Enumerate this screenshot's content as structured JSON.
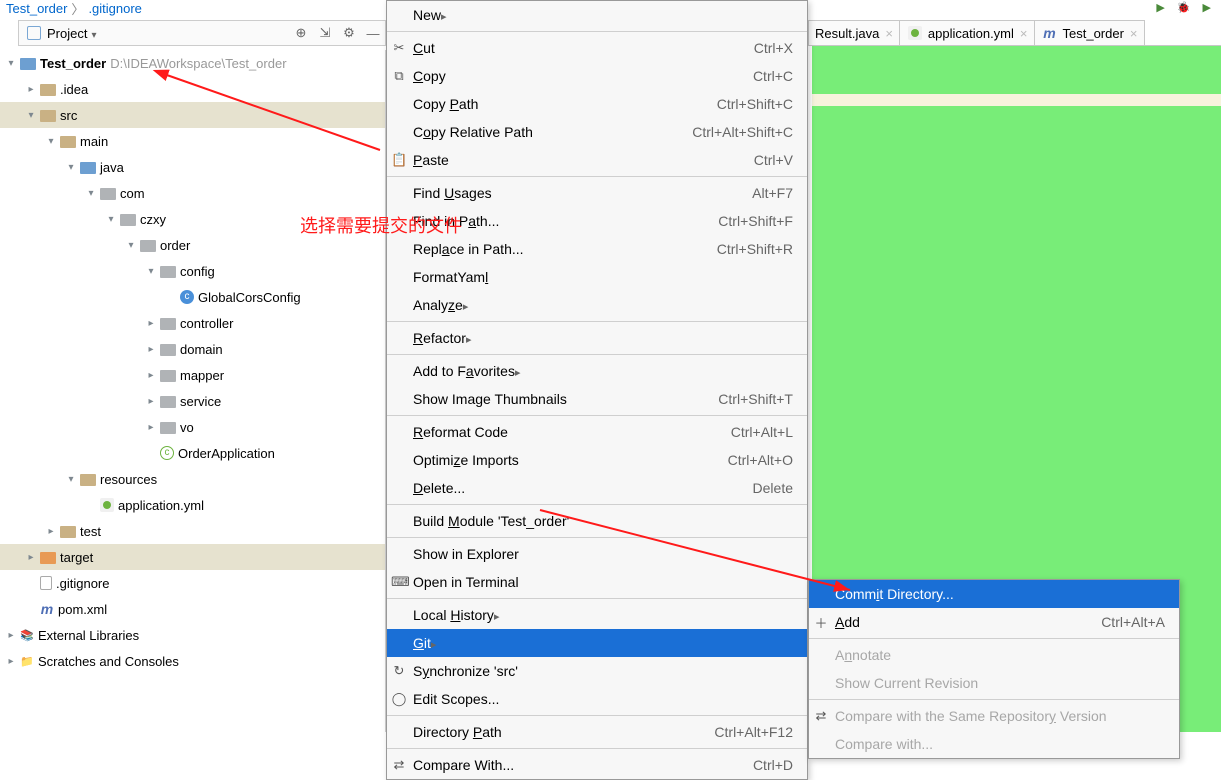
{
  "breadcrumb": {
    "a": "Test_order",
    "b": ".gitignore"
  },
  "project_pane": {
    "title": "Project"
  },
  "tree": {
    "root": {
      "name": "Test_order",
      "path": "D:\\IDEAWorkspace\\Test_order"
    },
    "idea": ".idea",
    "src": "src",
    "main": "main",
    "java": "java",
    "com": "com",
    "czxy": "czxy",
    "order": "order",
    "config": "config",
    "globalcors": "GlobalCorsConfig",
    "controller": "controller",
    "domain": "domain",
    "mapper": "mapper",
    "service": "service",
    "vo": "vo",
    "orderapp": "OrderApplication",
    "resources": "resources",
    "appyml": "application.yml",
    "test": "test",
    "target": "target",
    "gitignore": ".gitignore",
    "pom": "pom.xml",
    "extlib": "External Libraries",
    "scratches": "Scratches and Consoles"
  },
  "ctx": {
    "new": "New",
    "cut": "Cut",
    "cut_sc": "Ctrl+X",
    "copy": "Copy",
    "copy_sc": "Ctrl+C",
    "copypath": "Copy Path",
    "copypath_sc": "Ctrl+Shift+C",
    "copyrel": "Copy Relative Path",
    "copyrel_sc": "Ctrl+Alt+Shift+C",
    "paste": "Paste",
    "paste_sc": "Ctrl+V",
    "findu": "Find Usages",
    "findu_sc": "Alt+F7",
    "findp": "Find in Path...",
    "findp_sc": "Ctrl+Shift+F",
    "replp": "Replace in Path...",
    "replp_sc": "Ctrl+Shift+R",
    "fyaml": "FormatYaml",
    "analyze": "Analyze",
    "refactor": "Refactor",
    "fav": "Add to Favorites",
    "thumbs": "Show Image Thumbnails",
    "thumbs_sc": "Ctrl+Shift+T",
    "reformat": "Reformat Code",
    "reformat_sc": "Ctrl+Alt+L",
    "optimp": "Optimize Imports",
    "optimp_sc": "Ctrl+Alt+O",
    "delete": "Delete...",
    "delete_sc": "Delete",
    "build": "Build Module 'Test_order'",
    "explorer": "Show in Explorer",
    "terminal": "Open in Terminal",
    "lhist": "Local History",
    "git": "Git",
    "sync": "Synchronize 'src'",
    "scopes": "Edit Scopes...",
    "dirpath": "Directory Path",
    "dirpath_sc": "Ctrl+Alt+F12",
    "compare": "Compare With...",
    "compare_sc": "Ctrl+D"
  },
  "sub": {
    "commit": "Commit Directory...",
    "add": "Add",
    "add_sc": "Ctrl+Alt+A",
    "annotate": "Annotate",
    "showrev": "Show Current Revision",
    "cmpsame": "Compare with the Same Repository Version",
    "cmpwith": "Compare with..."
  },
  "tabs": {
    "t1": "Result.java",
    "t2": "application.yml",
    "t3": "Test_order"
  },
  "annotation": "选择需要提交的文件"
}
